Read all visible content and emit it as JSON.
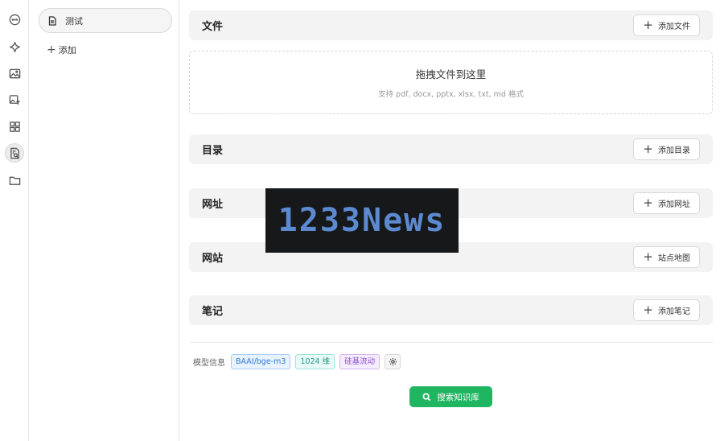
{
  "rail": {
    "icons": [
      "chat-icon",
      "sparkle-icon",
      "image-icon",
      "image-edit-icon",
      "apps-icon",
      "knowledge-base-icon",
      "folder-icon"
    ]
  },
  "list": {
    "item_label": "测试",
    "add_label": "添加"
  },
  "sections": {
    "files": {
      "title": "文件",
      "button": "添加文件"
    },
    "dropzone": {
      "title": "拖拽文件到这里",
      "subtitle": "支持 pdf, docx, pptx, xlsx, txt, md 格式"
    },
    "directory": {
      "title": "目录",
      "button": "添加目录"
    },
    "url": {
      "title": "网址",
      "button": "添加网址"
    },
    "website": {
      "title": "网站",
      "button": "站点地图"
    },
    "notes": {
      "title": "笔记",
      "button": "添加笔记"
    }
  },
  "model": {
    "label": "模型信息",
    "model_tag": "BAAI/bge-m3",
    "dims_tag": "1024 维",
    "provider_tag": "硅基流动"
  },
  "search_button": "搜索知识库",
  "watermark": "1233News",
  "colors": {
    "accent_green": "#20b561",
    "tag_blue": "#2f7ad6",
    "tag_cyan": "#2a9b87",
    "tag_purple": "#8c4fd0"
  }
}
